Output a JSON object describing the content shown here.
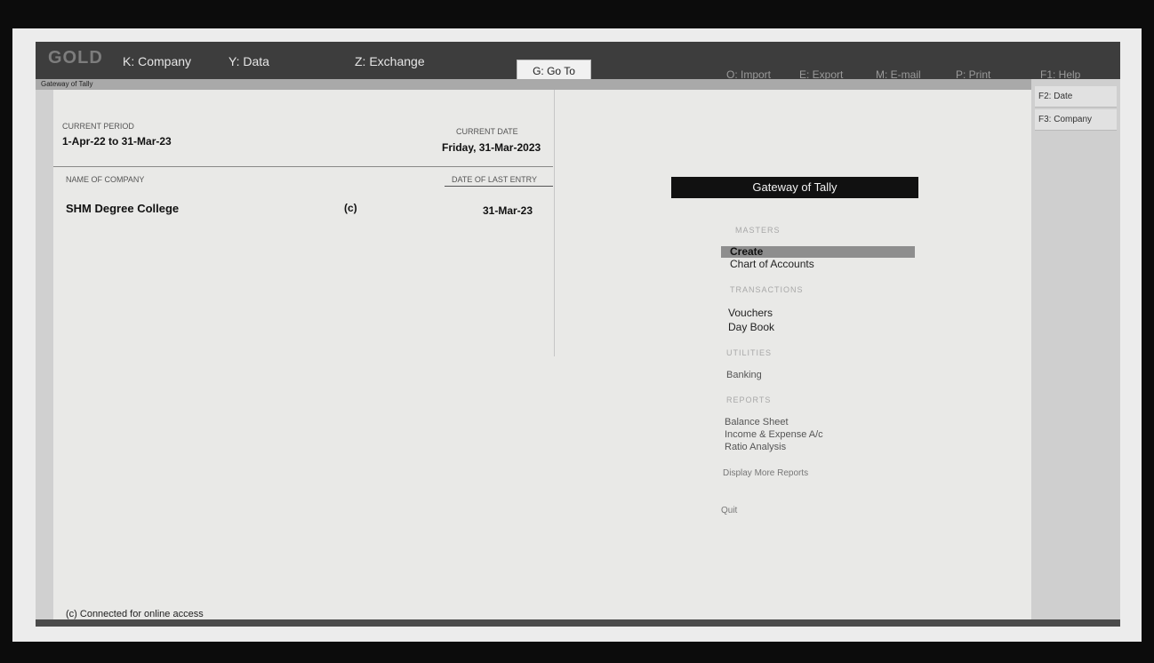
{
  "app": {
    "logo": "GOLD"
  },
  "menu": {
    "company": "K: Company",
    "data": "Y: Data",
    "exchange": "Z: Exchange",
    "goto": "G: Go To",
    "import": "O: Import",
    "export": "E: Export",
    "email": "M: E-mail",
    "print": "P: Print",
    "help": "F1: Help"
  },
  "breadcrumb": "Gateway of Tally",
  "fkeys": [
    "F2: Date",
    "F3: Company"
  ],
  "info": {
    "current_period_label": "CURRENT PERIOD",
    "current_period": "1-Apr-22 to 31-Mar-23",
    "current_date_label": "CURRENT DATE",
    "current_date": "Friday, 31-Mar-2023",
    "company_col_label": "NAME OF COMPANY",
    "last_entry_col_label": "DATE OF LAST ENTRY",
    "company_name": "SHM Degree College",
    "company_flag": "(c)",
    "last_entry": "31-Mar-23"
  },
  "gateway": {
    "title": "Gateway of Tally",
    "masters": "MASTERS",
    "create": "Create",
    "chart_of_accounts": "Chart of Accounts",
    "transactions": "TRANSACTIONS",
    "vouchers": "Vouchers",
    "day_book": "Day Book",
    "utilities": "UTILITIES",
    "banking": "Banking",
    "reports": "REPORTS",
    "balance_sheet": "Balance Sheet",
    "income_expense": "Income & Expense A/c",
    "ratio_analysis": "Ratio Analysis",
    "more_reports": "Display More Reports",
    "quit": "Quit"
  },
  "status": "(c) Connected for online access"
}
